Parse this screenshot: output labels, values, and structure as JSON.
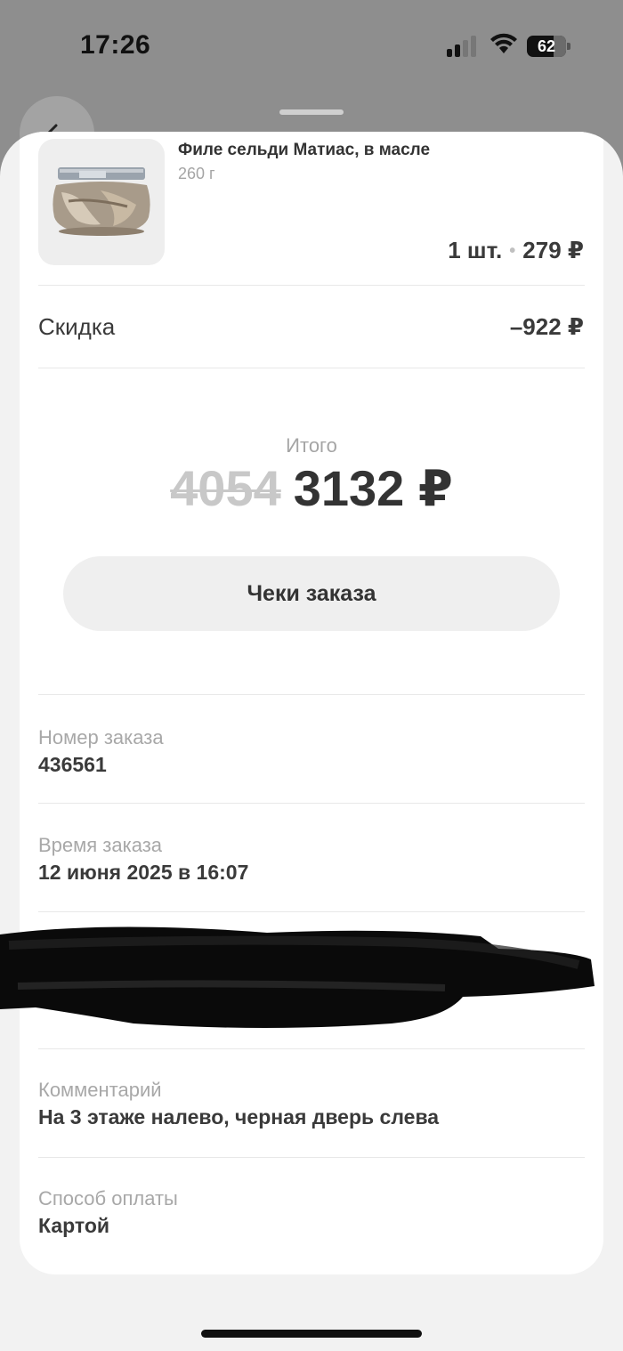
{
  "status_bar": {
    "time": "17:26",
    "battery": "62"
  },
  "product": {
    "name": "Филе сельди Матиас, в масле",
    "weight": "260 г",
    "quantity": "1 шт.",
    "price": "279 ₽",
    "image_icon": "herring-jar-image"
  },
  "discount": {
    "label": "Скидка",
    "value": "–922 ₽"
  },
  "total": {
    "label": "Итого",
    "old_value": "4054",
    "new_value": "3132 ₽"
  },
  "receipts_button": {
    "label": "Чеки заказа"
  },
  "order_number": {
    "label": "Номер заказа",
    "value": "436561"
  },
  "order_time": {
    "label": "Время заказа",
    "value": "12 июня 2025 в 16:07"
  },
  "comment": {
    "label": "Комментарий",
    "value": "На 3 этаже налево, черная дверь слева"
  },
  "payment": {
    "label": "Способ оплаты",
    "value": "Картой"
  },
  "colors": {
    "sheet_bg": "#f2f2f2",
    "card_bg": "#ffffff",
    "backdrop": "#8e8e8e",
    "text": "#333333",
    "muted": "#a5a5a5"
  }
}
